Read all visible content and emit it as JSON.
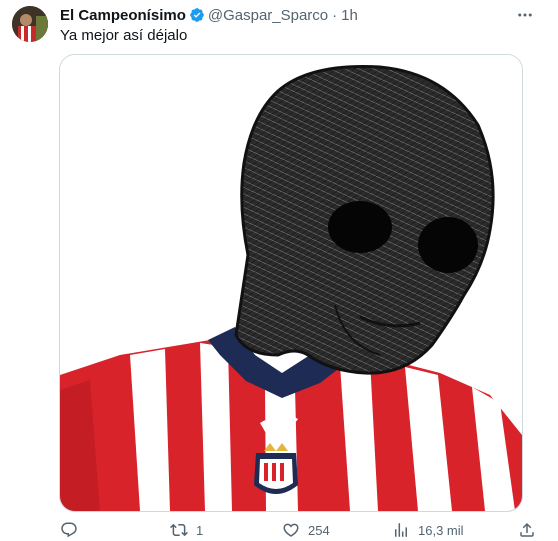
{
  "tweet": {
    "author_name": "El Campeonísimo",
    "handle": "@Gaspar_Sparco",
    "separator": "·",
    "time": "1h",
    "text": "Ya mejor así déjalo",
    "more_label": "···"
  },
  "actions": {
    "replies": "",
    "retweets": "1",
    "likes": "254",
    "views": "16,3 mil"
  },
  "colors": {
    "verified": "#1d9bf0",
    "secondary_text": "#536471",
    "jersey_red": "#d8232a",
    "jersey_navy": "#1e2c55"
  },
  "icons": [
    "verified-badge-icon",
    "more-icon",
    "reply-icon",
    "retweet-icon",
    "like-icon",
    "views-icon",
    "share-icon"
  ]
}
